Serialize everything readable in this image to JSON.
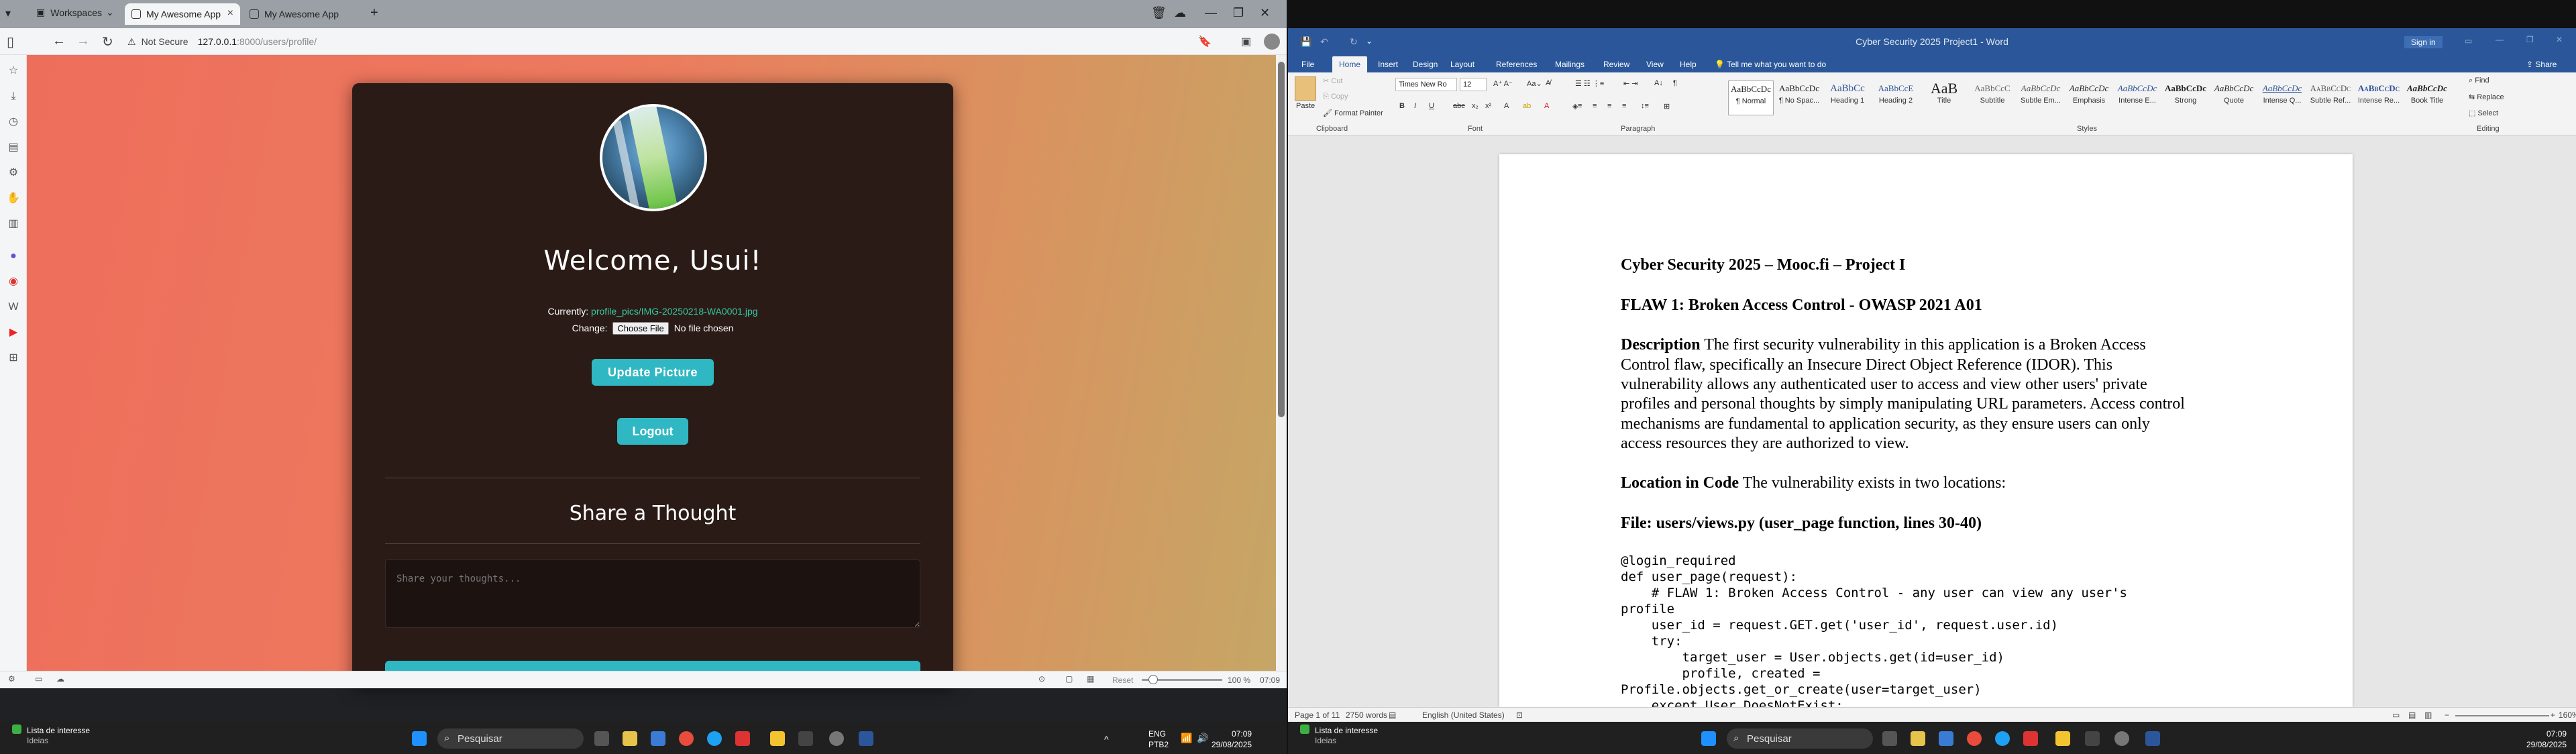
{
  "browser": {
    "workspaces_label": "Workspaces",
    "tabs": [
      {
        "label": "My Awesome App"
      },
      {
        "label": "My Awesome App"
      }
    ],
    "new_tab": "+",
    "not_secure": "Not Secure",
    "url_host": "127.0.0.1",
    "url_path": ":8000/users/profile/",
    "zoom_reset": "Reset",
    "zoom_level": "100 %",
    "status_time": "07:09"
  },
  "profile_page": {
    "welcome": "Welcome, Usui!",
    "currently_label": "Currently:",
    "currently_file": "profile_pics/IMG-20250218-WA0001.jpg",
    "change_label": "Change:",
    "choose_file": "Choose File",
    "no_file": "No file chosen",
    "update_button": "Update Picture",
    "logout_button": "Logout",
    "share_heading": "Share a Thought",
    "thought_placeholder": "Share your thoughts..."
  },
  "word": {
    "window_title": "Cyber Security 2025 Project1 - Word",
    "sign_in": "Sign in",
    "menu": [
      "File",
      "Home",
      "Insert",
      "Design",
      "Layout",
      "References",
      "Mailings",
      "Review",
      "View",
      "Help"
    ],
    "tell_me": "Tell me what you want to do",
    "share": "Share",
    "clipboard": {
      "paste": "Paste",
      "cut": "Cut",
      "copy": "Copy",
      "format_painter": "Format Painter",
      "label": "Clipboard"
    },
    "font": {
      "name": "Times New Ro",
      "size": "12",
      "label": "Font"
    },
    "paragraph_label": "Paragraph",
    "styles_label": "Styles",
    "editing_label": "Editing",
    "editing": {
      "find": "Find",
      "replace": "Replace",
      "select": "Select"
    },
    "styles": [
      {
        "sample": "AaBbCcDc",
        "name": "¶ Normal"
      },
      {
        "sample": "AaBbCcDc",
        "name": "¶ No Spac..."
      },
      {
        "sample": "AaBbCc",
        "name": "Heading 1"
      },
      {
        "sample": "AaBbCcE",
        "name": "Heading 2"
      },
      {
        "sample": "AaB",
        "name": "Title"
      },
      {
        "sample": "AaBbCcC",
        "name": "Subtitle"
      },
      {
        "sample": "AaBbCcDc",
        "name": "Subtle Em..."
      },
      {
        "sample": "AaBbCcDc",
        "name": "Emphasis"
      },
      {
        "sample": "AaBbCcDc",
        "name": "Intense E..."
      },
      {
        "sample": "AaBbCcDc",
        "name": "Strong"
      },
      {
        "sample": "AaBbCcDc",
        "name": "Quote"
      },
      {
        "sample": "AaBbCcDc",
        "name": "Intense Q..."
      },
      {
        "sample": "AaBbCcDc",
        "name": "Subtle Ref..."
      },
      {
        "sample": "AaBbCcDc",
        "name": "Intense Re..."
      },
      {
        "sample": "AaBbCcDc",
        "name": "Book Title"
      }
    ],
    "doc": {
      "title": "Cyber Security 2025 – Mooc.fi – Project I",
      "flaw": "FLAW 1: Broken Access Control - OWASP 2021 A01",
      "desc_label": "Description",
      "desc_lines": [
        " The first security vulnerability in this application is a Broken Access",
        "Control flaw, specifically an Insecure Direct Object Reference (IDOR). This",
        "vulnerability allows any authenticated user to access and view other users' private",
        "profiles and personal thoughts by simply manipulating URL parameters. Access control",
        "mechanisms are fundamental to application security, as they ensure users can only",
        "access resources they are authorized to view."
      ],
      "loc_label": "Location in Code",
      "loc_text": " The vulnerability exists in two locations:",
      "file_label": "File: users/views.py (user_page function, lines 30-40)",
      "code": [
        "@login_required",
        "def user_page(request):",
        "    # FLAW 1: Broken Access Control - any user can view any user's",
        "profile",
        "    user_id = request.GET.get('user_id', request.user.id)",
        "    try:",
        "        target_user = User.objects.get(id=user_id)",
        "        profile, created =",
        "Profile.objects.get_or_create(user=target_user)",
        "    except User.DoesNotExist:"
      ]
    },
    "status": {
      "page": "Page 1 of 11",
      "words": "2750 words",
      "lang": "English (United States)",
      "zoom": "160%"
    }
  },
  "taskbar": {
    "weather_title": "Lista de interesse",
    "weather_sub": "Ideias",
    "search": "Pesquisar",
    "lang": "ENG",
    "lang2": "PTB2",
    "time": "07:09",
    "date": "29/08/2025"
  }
}
